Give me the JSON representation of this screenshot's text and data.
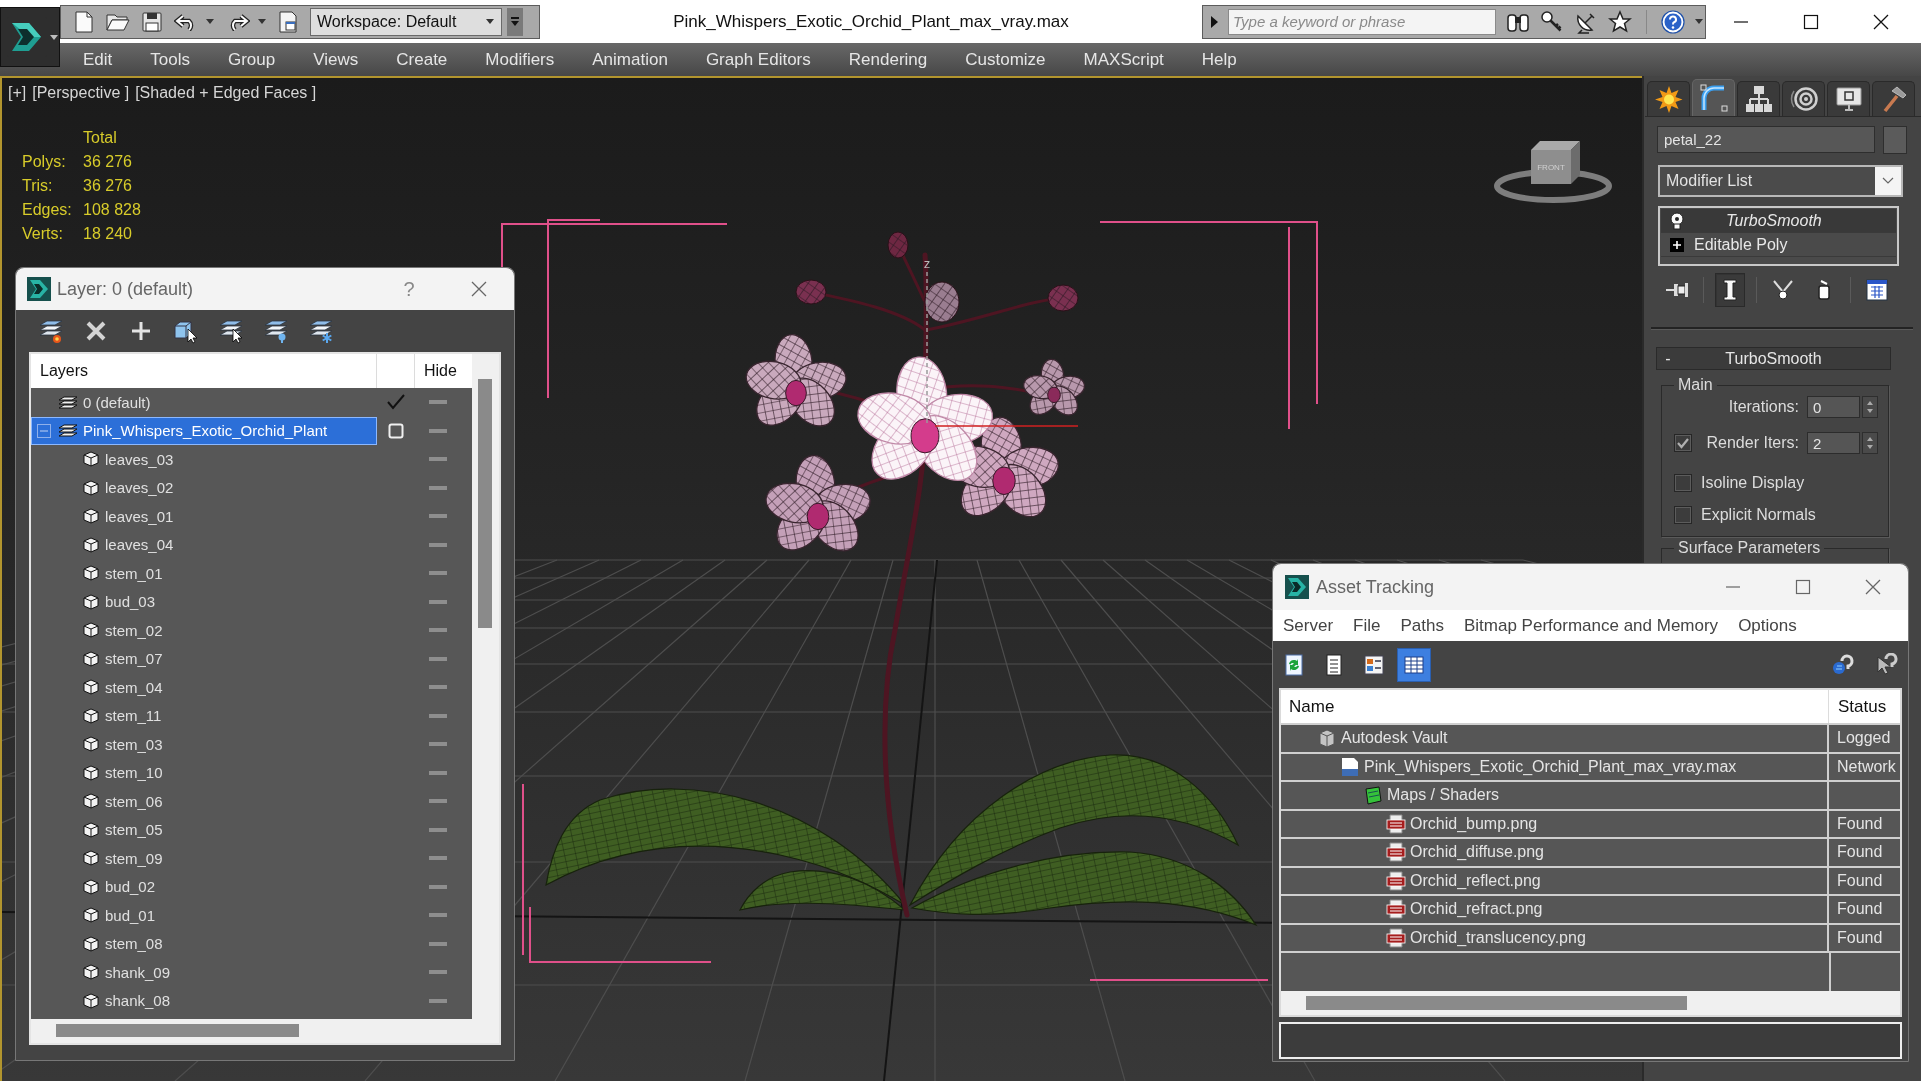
{
  "app": {
    "title": "Pink_Whispers_Exotic_Orchid_Plant_max_vray.max",
    "workspace": "Workspace: Default",
    "search": {
      "placeholder": "Type a keyword or phrase"
    }
  },
  "menu": [
    "Edit",
    "Tools",
    "Group",
    "Views",
    "Create",
    "Modifiers",
    "Animation",
    "Graph Editors",
    "Rendering",
    "Customize",
    "MAXScript",
    "Help"
  ],
  "viewport": {
    "labels": [
      "[+]",
      "[Perspective ]",
      "[Shaded + Edged Faces ]"
    ],
    "stats": {
      "header": "Total",
      "rows": [
        {
          "label": "Polys:",
          "value": "36 276"
        },
        {
          "label": "Tris:",
          "value": "36 276"
        },
        {
          "label": "Edges:",
          "value": "108 828"
        },
        {
          "label": "Verts:",
          "value": "18 240"
        }
      ]
    },
    "view_cube": {
      "face_label": "FRONT"
    },
    "gizmo": {
      "axis_label": "z"
    }
  },
  "layer_window": {
    "title": "Layer: 0 (default)",
    "help": "?",
    "columns": [
      "Layers",
      "Hide"
    ],
    "layers": [
      {
        "kind": "layer",
        "name": "0 (default)",
        "selected": false,
        "current": true,
        "hidden": false
      },
      {
        "kind": "layer",
        "name": "Pink_Whispers_Exotic_Orchid_Plant",
        "selected": true,
        "current": false,
        "hidden": false,
        "expanded": true,
        "children": [
          {
            "kind": "object",
            "name": "leaves_03",
            "selected": false,
            "hidden": false
          },
          {
            "kind": "object",
            "name": "leaves_02",
            "selected": false,
            "hidden": false
          },
          {
            "kind": "object",
            "name": "leaves_01",
            "selected": false,
            "hidden": false
          },
          {
            "kind": "object",
            "name": "leaves_04",
            "selected": false,
            "hidden": false
          },
          {
            "kind": "object",
            "name": "stem_01",
            "selected": false,
            "hidden": false
          },
          {
            "kind": "object",
            "name": "bud_03",
            "selected": false,
            "hidden": false
          },
          {
            "kind": "object",
            "name": "stem_02",
            "selected": false,
            "hidden": false
          },
          {
            "kind": "object",
            "name": "stem_07",
            "selected": false,
            "hidden": false
          },
          {
            "kind": "object",
            "name": "stem_04",
            "selected": false,
            "hidden": false
          },
          {
            "kind": "object",
            "name": "stem_11",
            "selected": false,
            "hidden": false
          },
          {
            "kind": "object",
            "name": "stem_03",
            "selected": false,
            "hidden": false
          },
          {
            "kind": "object",
            "name": "stem_10",
            "selected": false,
            "hidden": false
          },
          {
            "kind": "object",
            "name": "stem_06",
            "selected": false,
            "hidden": false
          },
          {
            "kind": "object",
            "name": "stem_05",
            "selected": false,
            "hidden": false
          },
          {
            "kind": "object",
            "name": "stem_09",
            "selected": false,
            "hidden": false
          },
          {
            "kind": "object",
            "name": "bud_02",
            "selected": false,
            "hidden": false
          },
          {
            "kind": "object",
            "name": "bud_01",
            "selected": false,
            "hidden": false
          },
          {
            "kind": "object",
            "name": "stem_08",
            "selected": false,
            "hidden": false
          },
          {
            "kind": "object",
            "name": "shank_09",
            "selected": false,
            "hidden": false
          },
          {
            "kind": "object",
            "name": "shank_08",
            "selected": false,
            "hidden": false
          }
        ]
      }
    ]
  },
  "command_panel": {
    "tabs": [
      {
        "kind": "create",
        "selected": false
      },
      {
        "kind": "modify",
        "selected": true
      },
      {
        "kind": "hierarchy",
        "selected": false
      },
      {
        "kind": "motion",
        "selected": false
      },
      {
        "kind": "display",
        "selected": false
      },
      {
        "kind": "utilities",
        "selected": false
      }
    ],
    "object_name": "petal_22",
    "modifier_list": "Modifier List",
    "stack": [
      {
        "kind": "modifier",
        "name": "TurboSmooth",
        "selected": true
      },
      {
        "kind": "object",
        "name": "Editable Poly",
        "selected": false,
        "expanded": false
      }
    ],
    "stack_tools": [
      {
        "kind": "pin",
        "on": false
      },
      {
        "kind": "end_result",
        "on": true
      },
      {
        "kind": "make_unique",
        "on": false
      },
      {
        "kind": "remove",
        "on": false
      },
      {
        "kind": "configure",
        "on": false
      }
    ],
    "rollout": {
      "collapse": "-",
      "title": "TurboSmooth",
      "group": "Main",
      "controls": [
        {
          "kind": "spinner",
          "label": "Iterations:",
          "value": "0"
        },
        {
          "kind": "spinner",
          "label": "Render Iters:",
          "value": "2",
          "checked": true
        },
        {
          "kind": "checkbox",
          "label": "Isoline Display",
          "checked": false
        },
        {
          "kind": "checkbox",
          "label": "Explicit Normals",
          "checked": false
        }
      ],
      "next_group": "Surface Parameters"
    }
  },
  "asset_window": {
    "title": "Asset Tracking",
    "menu": [
      "Server",
      "File",
      "Paths",
      "Bitmap Performance and Memory",
      "Options"
    ],
    "toolbar": [
      {
        "kind": "refresh",
        "selected": false
      },
      {
        "kind": "list",
        "selected": false
      },
      {
        "kind": "thumbnails",
        "selected": false
      },
      {
        "kind": "table",
        "selected": true
      }
    ],
    "columns": [
      "Name",
      "Status"
    ],
    "assets": [
      {
        "kind": "vault",
        "name": "Autodesk Vault",
        "status": "Logged",
        "selected": false,
        "children": [
          {
            "kind": "max",
            "name": "Pink_Whispers_Exotic_Orchid_Plant_max_vray.max",
            "status": "Network",
            "selected": false,
            "children": [
              {
                "kind": "maps",
                "name": "Maps / Shaders",
                "selected": false,
                "children": [
                  {
                    "kind": "png",
                    "name": "Orchid_bump.png",
                    "status": "Found",
                    "selected": false
                  },
                  {
                    "kind": "png",
                    "name": "Orchid_diffuse.png",
                    "status": "Found",
                    "selected": false
                  },
                  {
                    "kind": "png",
                    "name": "Orchid_reflect.png",
                    "status": "Found",
                    "selected": false
                  },
                  {
                    "kind": "png",
                    "name": "Orchid_refract.png",
                    "status": "Found",
                    "selected": false
                  },
                  {
                    "kind": "png",
                    "name": "Orchid_translucency.png",
                    "status": "Found",
                    "selected": false
                  }
                ]
              }
            ]
          }
        ]
      }
    ]
  }
}
